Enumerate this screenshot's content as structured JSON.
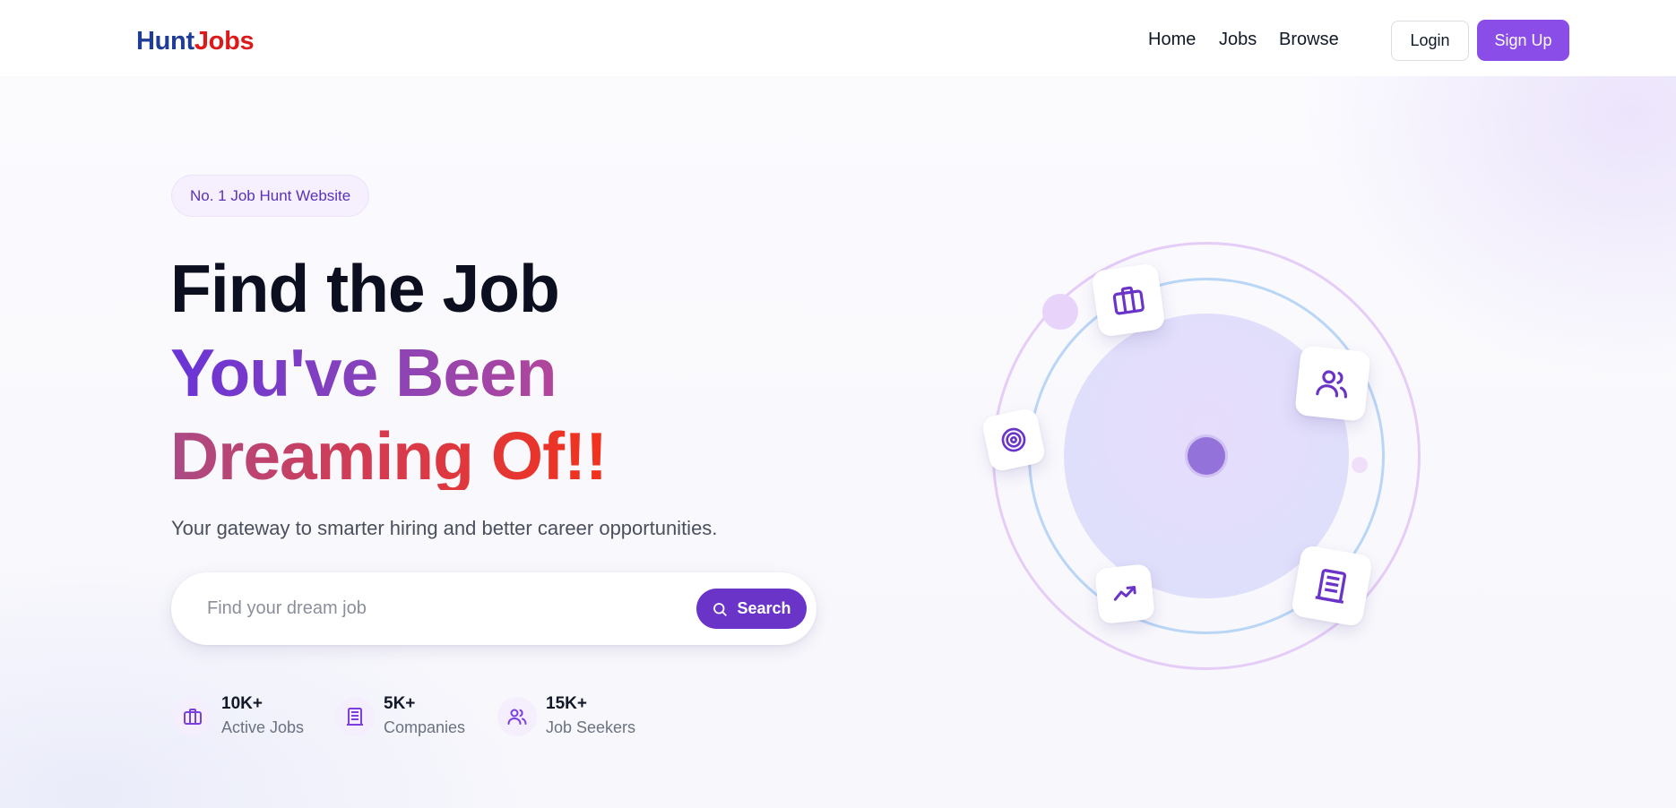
{
  "brand": {
    "part1": "Hunt",
    "part2": "Jobs",
    "color1": "#1f3c96",
    "color2": "#dc1a1a"
  },
  "nav": {
    "items": [
      "Home",
      "Jobs",
      "Browse"
    ]
  },
  "auth": {
    "login_label": "Login",
    "signup_label": "Sign Up",
    "accent": "#8a4de8"
  },
  "hero": {
    "badge": "No. 1 Job Hunt Website",
    "line1": "Find the Job",
    "line2": "You've Been",
    "line3": "Dreaming Of!!",
    "tagline": "Your gateway to smarter hiring and better career opportunities."
  },
  "search": {
    "placeholder": "Find your dream job",
    "value": "",
    "button_label": "Search",
    "button_icon": "search-icon"
  },
  "stats": [
    {
      "value": "10K+",
      "label": "Active Jobs",
      "icon": "briefcase-icon"
    },
    {
      "value": "5K+",
      "label": "Companies",
      "icon": "building-icon"
    },
    {
      "value": "15K+",
      "label": "Job Seekers",
      "icon": "users-icon"
    }
  ],
  "illustration": {
    "cards": [
      "briefcase-icon",
      "users-icon",
      "target-icon",
      "trending-up-icon",
      "building-icon"
    ]
  }
}
